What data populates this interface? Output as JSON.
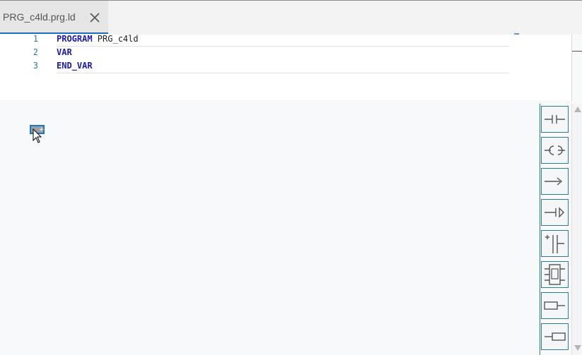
{
  "tab": {
    "title": "PRG_c4ld.prg.ld",
    "close_icon": "close-icon"
  },
  "editor": {
    "lines": [
      {
        "number": "1",
        "keyword": "PROGRAM",
        "rest": " PRG_c4ld"
      },
      {
        "number": "2",
        "keyword": "VAR",
        "rest": ""
      },
      {
        "number": "3",
        "keyword": "END_VAR",
        "rest": ""
      }
    ]
  },
  "canvas": {
    "selected_element": "contact-icon",
    "cursor": "pointer-plus-cursor"
  },
  "toolbox": {
    "tools": [
      {
        "icon": "contact-icon"
      },
      {
        "icon": "coil-icon"
      },
      {
        "icon": "jump-icon"
      },
      {
        "icon": "return-icon"
      },
      {
        "icon": "power-rail-icon"
      },
      {
        "icon": "function-block-icon"
      },
      {
        "icon": "input-variable-icon"
      },
      {
        "icon": "output-variable-icon"
      }
    ]
  },
  "colors": {
    "accent": "#1b6fb8",
    "keyword": "#1b1bb5",
    "line_number": "#2b7bb5",
    "toolbox_border": "#2c7f92"
  }
}
